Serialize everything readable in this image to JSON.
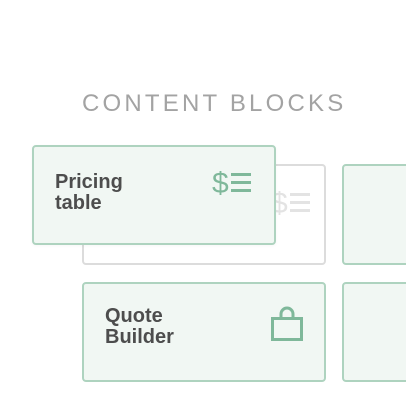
{
  "section": {
    "title": "CONTENT BLOCKS"
  },
  "blocks": {
    "pricing_table": {
      "label_line1": "Pricing",
      "label_line2": "table",
      "icon": "dollar-list-icon"
    },
    "quote_builder": {
      "label_line1": "Quote",
      "label_line2": "Builder",
      "icon": "shopping-bag-icon"
    }
  },
  "colors": {
    "accent": "#7fb89a",
    "card_background": "#f1f7f3",
    "card_border": "#aed3bf",
    "placeholder_border": "#dcdcdc",
    "placeholder_icon": "#e3e3e3",
    "heading": "#a3a3a3",
    "label": "#4d4d4d"
  }
}
